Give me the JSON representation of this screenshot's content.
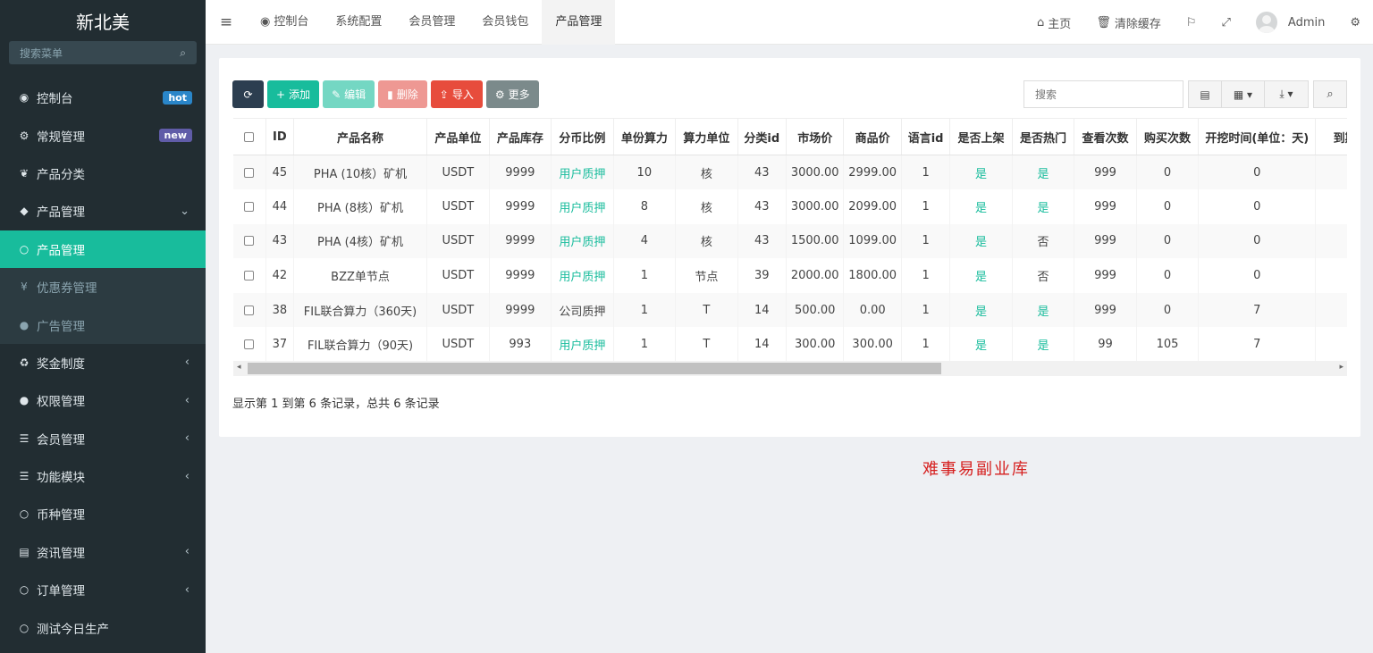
{
  "sidebar": {
    "brand": "新北美",
    "search_placeholder": "搜索菜单",
    "items": [
      {
        "icon": "dashboard-icon",
        "glyph": "◉",
        "label": "控制台",
        "badge": "hot",
        "badge_color": "#2a86c9"
      },
      {
        "icon": "cogs-icon",
        "glyph": "⚙",
        "label": "常规管理",
        "badge": "new",
        "badge_color": "#605ca8"
      },
      {
        "icon": "leaf-icon",
        "glyph": "❦",
        "label": "产品分类"
      },
      {
        "icon": "diamond-icon",
        "glyph": "◆",
        "label": "产品管理",
        "arrow": "⌄"
      },
      {
        "icon": "circle-icon",
        "glyph": "○",
        "label": "产品管理"
      },
      {
        "icon": "yen-icon",
        "glyph": "¥",
        "label": "优惠券管理"
      },
      {
        "icon": "circle-icon",
        "glyph": "●",
        "label": "广告管理"
      },
      {
        "icon": "recycle-icon",
        "glyph": "♻",
        "label": "奖金制度",
        "arrow": "‹"
      },
      {
        "icon": "users-icon",
        "glyph": "●",
        "label": "权限管理",
        "arrow": "‹"
      },
      {
        "icon": "list-icon",
        "glyph": "☰",
        "label": "会员管理",
        "arrow": "‹"
      },
      {
        "icon": "list-icon",
        "glyph": "☰",
        "label": "功能模块",
        "arrow": "‹"
      },
      {
        "icon": "circle-icon",
        "glyph": "○",
        "label": "币种管理"
      },
      {
        "icon": "newspaper-icon",
        "glyph": "▤",
        "label": "资讯管理",
        "arrow": "‹"
      },
      {
        "icon": "circle-icon",
        "glyph": "○",
        "label": "订单管理",
        "arrow": "‹"
      },
      {
        "icon": "circle-icon",
        "glyph": "○",
        "label": "测试今日生产"
      }
    ]
  },
  "topbar": {
    "tabs": [
      {
        "icon": "dashboard-icon",
        "glyph": "◉",
        "label": "控制台"
      },
      {
        "label": "系统配置"
      },
      {
        "label": "会员管理"
      },
      {
        "label": "会员钱包"
      },
      {
        "label": "产品管理"
      }
    ],
    "home": "主页",
    "clear_cache": "清除缓存",
    "user": "Admin"
  },
  "toolbar": {
    "add": "添加",
    "edit": "编辑",
    "delete": "删除",
    "import": "导入",
    "more": "更多",
    "search_placeholder": "搜索"
  },
  "table": {
    "headers": [
      "ID",
      "产品名称",
      "产品单位",
      "产品库存",
      "分币比例",
      "单份算力",
      "算力单位",
      "分类id",
      "市场价",
      "商品价",
      "语言id",
      "是否上架",
      "是否热门",
      "查看次数",
      "购买次数",
      "开挖时间(单位：天)",
      "到期时"
    ],
    "rows": [
      [
        "45",
        "PHA (10核）矿机",
        "USDT",
        "9999",
        "用户质押",
        "10",
        "核",
        "43",
        "3000.00",
        "2999.00",
        "1",
        "是",
        "是",
        "999",
        "0",
        "0",
        ""
      ],
      [
        "44",
        "PHA (8核）矿机",
        "USDT",
        "9999",
        "用户质押",
        "8",
        "核",
        "43",
        "3000.00",
        "2099.00",
        "1",
        "是",
        "是",
        "999",
        "0",
        "0",
        ""
      ],
      [
        "43",
        "PHA (4核）矿机",
        "USDT",
        "9999",
        "用户质押",
        "4",
        "核",
        "43",
        "1500.00",
        "1099.00",
        "1",
        "是",
        "否",
        "999",
        "0",
        "0",
        ""
      ],
      [
        "42",
        "BZZ单节点",
        "USDT",
        "9999",
        "用户质押",
        "1",
        "节点",
        "39",
        "2000.00",
        "1800.00",
        "1",
        "是",
        "否",
        "999",
        "0",
        "0",
        ""
      ],
      [
        "38",
        "FIL联合算力（360天)",
        "USDT",
        "9999",
        "公司质押",
        "1",
        "T",
        "14",
        "500.00",
        "0.00",
        "1",
        "是",
        "是",
        "999",
        "0",
        "7",
        ""
      ],
      [
        "37",
        "FIL联合算力（90天)",
        "USDT",
        "993",
        "用户质押",
        "1",
        "T",
        "14",
        "300.00",
        "300.00",
        "1",
        "是",
        "是",
        "99",
        "105",
        "7",
        ""
      ]
    ],
    "green_values": [
      "用户质押",
      "是"
    ]
  },
  "pager": {
    "info": "显示第 1 到第 6 条记录，总共 6 条记录"
  },
  "watermark": "难事易副业库",
  "colors": {
    "sidebar_bg": "#222d32",
    "accent": "#18bc9c",
    "danger": "#e74c3c",
    "dark": "#2c3e50"
  }
}
